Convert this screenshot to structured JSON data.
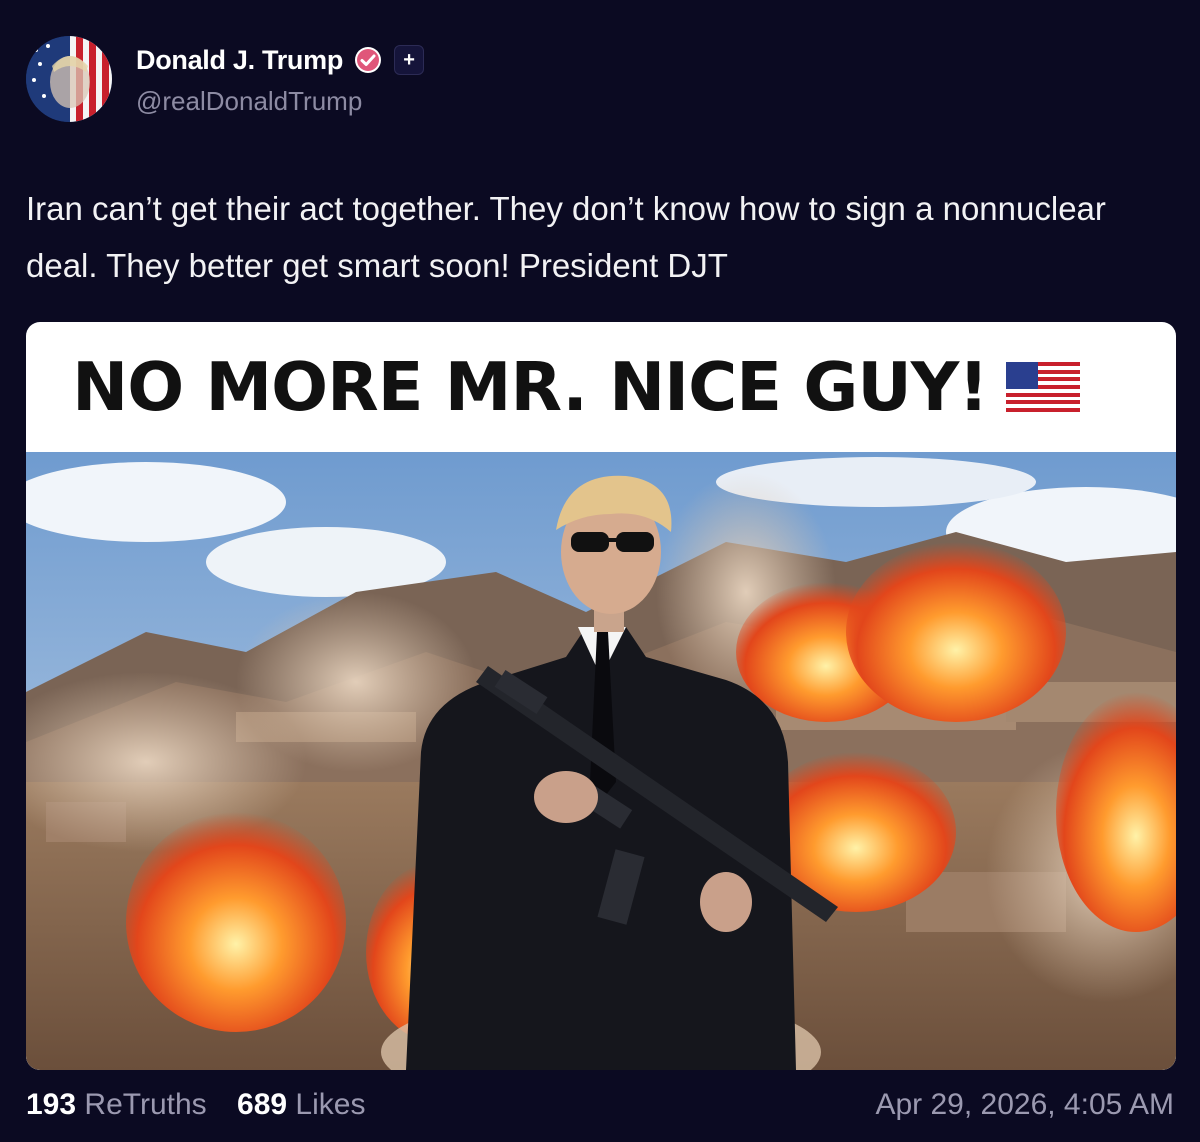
{
  "post": {
    "author": {
      "display_name": "Donald J. Trump",
      "handle": "@realDonaldTrump",
      "verified_icon": "verified-badge-icon",
      "follow_icon": "plus-icon",
      "follow_symbol": "+"
    },
    "text": "Iran can’t get their act together. They don’t know how to sign a nonnuclear deal. They better get smart soon! President DJT",
    "media": {
      "headline": "NO MORE MR. NICE GUY!",
      "headline_icon": "us-flag-emoji",
      "image_icon": "man-with-rifle-explosions-image"
    },
    "stats": {
      "retruths_count": "193",
      "retruths_label": "ReTruths",
      "likes_count": "689",
      "likes_label": "Likes"
    },
    "timestamp": "Apr 29, 2026, 4:05 AM"
  },
  "colors": {
    "background": "#0b0a22",
    "verified_badge": "#e0567a",
    "muted_text": "#9b99b0"
  }
}
